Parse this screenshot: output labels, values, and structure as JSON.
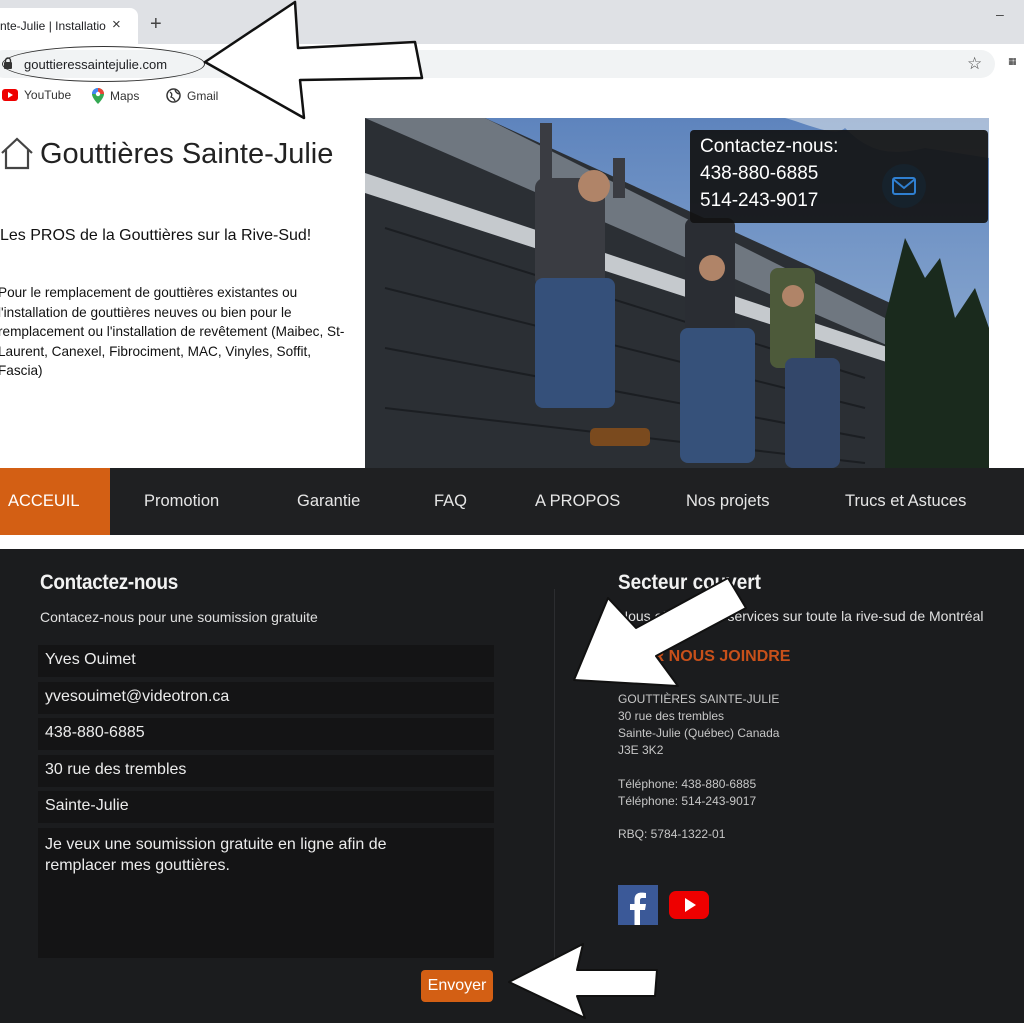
{
  "browser": {
    "tab_title": "nte-Julie | Installatio",
    "tab_close": "×",
    "new_tab": "+",
    "minimize": "–",
    "url": "gouttieressaintejulie.com",
    "star": "☆",
    "bookmarks": [
      {
        "label": "YouTube",
        "icon": "youtube-icon"
      },
      {
        "label": "Maps",
        "icon": "maps-icon"
      },
      {
        "label": "Gmail",
        "icon": "globe-icon"
      }
    ]
  },
  "hero": {
    "site_title": "Gouttières Sainte-Julie",
    "tagline": "Les PROS de la Gouttières sur la Rive-Sud!",
    "description": "Pour le remplacement de gouttières existantes ou l'installation de gouttières neuves ou bien  pour le remplacement ou l'installation de revêtement (Maibec, St-Laurent, Canexel, Fibrociment, MAC, Vinyles, Soffit, Fascia)",
    "contact_title": "Contactez-nous:",
    "phone1": "438-880-6885",
    "phone2": "514-243-9017"
  },
  "nav": {
    "items": [
      "ACCEUIL",
      "Promotion",
      "Garantie",
      "FAQ",
      "A PROPOS",
      "Nos projets",
      "Trucs et Astuces"
    ],
    "active_color": "#d35f14"
  },
  "form": {
    "title": "Contactez-nous",
    "subtitle": "Contacez-nous pour une soumission gratuite",
    "name": "Yves Ouimet",
    "email": "yvesouimet@videotron.ca",
    "phone": "438-880-6885",
    "address": "30 rue des trembles",
    "city": "Sainte-Julie",
    "message": "Je veux une soumission gratuite en ligne afin de\nremplacer mes gouttières.",
    "send": "Envoyer"
  },
  "sector": {
    "title": "Secteur couvert",
    "text": "Nous offrons nos services sur toute la rive-sud de Montréal",
    "join_title": "POUR NOUS JOINDRE",
    "company": "GOUTTIÈRES SAINTE-JULIE",
    "street": "30 rue des trembles",
    "city": "Sainte-Julie (Québec) Canada",
    "postal": "J3E 3K2",
    "tel1": "Téléphone: 438-880-6885",
    "tel2": "Téléphone: 514-243-9017",
    "rbq": "RBQ: 5784-1322-01"
  }
}
